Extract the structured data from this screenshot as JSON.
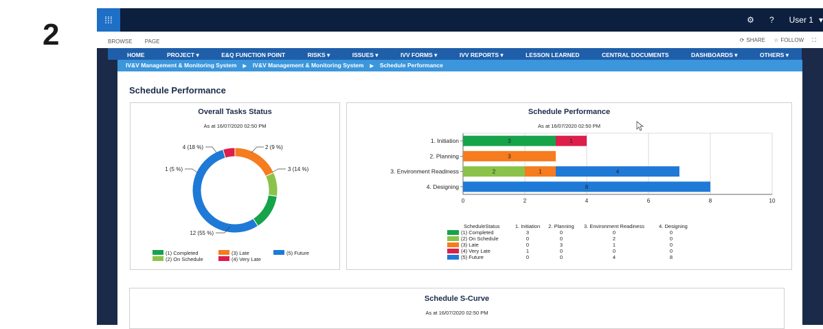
{
  "slide_number": "2",
  "suitebar": {
    "user": "User 1",
    "help": "?"
  },
  "ribbon": {
    "tabs": [
      "BROWSE",
      "PAGE"
    ],
    "share": "SHARE",
    "follow": "FOLLOW"
  },
  "nav": [
    "HOME",
    "PROJECT ▾",
    "E&Q FUNCTION POINT",
    "RISKS ▾",
    "ISSUES ▾",
    "IVV FORMS ▾",
    "IVV REPORTS ▾",
    "LESSON LEARNED",
    "CENTRAL DOCUMENTS",
    "DASHBOARDS ▾",
    "OTHERS ▾"
  ],
  "breadcrumb": [
    "IV&V Management & Monitoring System",
    "IV&V Management & Monitoring System",
    "Schedule Performance"
  ],
  "page_title": "Schedule Performance",
  "colors": {
    "completed": "#16a34a",
    "on_schedule": "#8bc34a",
    "late": "#f57c1f",
    "very_late": "#dc1e4b",
    "future": "#1e7ad6"
  },
  "donut": {
    "title": "Overall Tasks Status",
    "subtitle": "As at 16/07/2020 02:50 PM",
    "labels": [
      "4 (18 %)",
      "2 (9 %)",
      "1 (5 %)",
      "3 (14 %)",
      "12 (55 %)"
    ],
    "legend": [
      "(1) Completed",
      "(2) On Schedule",
      "(3) Late",
      "(4) Very Late",
      "(5) Future"
    ]
  },
  "bar": {
    "title": "Schedule Performance",
    "subtitle": "As at 16/07/2020 02:50 PM",
    "table_header": [
      "ScheduleStatus",
      "1. Initiation",
      "2. Planning",
      "3. Environment Readiness",
      "4. Designing"
    ],
    "table_rows": [
      [
        "(1) Completed",
        "3",
        "0",
        "0",
        "0"
      ],
      [
        "(2) On Schedule",
        "0",
        "0",
        "2",
        "0"
      ],
      [
        "(3) Late",
        "0",
        "3",
        "1",
        "0"
      ],
      [
        "(4) Very Late",
        "1",
        "0",
        "0",
        "0"
      ],
      [
        "(5) Future",
        "0",
        "0",
        "4",
        "8"
      ]
    ]
  },
  "scurve": {
    "title": "Schedule S-Curve",
    "subtitle": "As at 16/07/2020 02:50 PM"
  },
  "chart_data": [
    {
      "type": "pie",
      "title": "Overall Tasks Status",
      "categories": [
        "(1) Completed",
        "(2) On Schedule",
        "(3) Late",
        "(4) Very Late",
        "(5) Future"
      ],
      "values": [
        3,
        2,
        4,
        1,
        12
      ],
      "percent_labels": [
        "14 %",
        "9 %",
        "18 %",
        "5 %",
        "55 %"
      ],
      "legend": "bottom"
    },
    {
      "type": "bar",
      "orientation": "horizontal",
      "stacked": true,
      "title": "Schedule Performance",
      "categories": [
        "1. Initiation",
        "2. Planning",
        "3. Environment Readiness",
        "4. Designing"
      ],
      "series": [
        {
          "name": "(1) Completed",
          "values": [
            3,
            0,
            0,
            0
          ]
        },
        {
          "name": "(2) On Schedule",
          "values": [
            0,
            0,
            2,
            0
          ]
        },
        {
          "name": "(3) Late",
          "values": [
            0,
            3,
            1,
            0
          ]
        },
        {
          "name": "(4) Very Late",
          "values": [
            1,
            0,
            0,
            0
          ]
        },
        {
          "name": "(5) Future",
          "values": [
            0,
            0,
            4,
            8
          ]
        }
      ],
      "xlim": [
        0,
        10
      ],
      "xticks": [
        "0",
        "2",
        "4",
        "6",
        "8",
        "10"
      ],
      "grid": true
    }
  ]
}
